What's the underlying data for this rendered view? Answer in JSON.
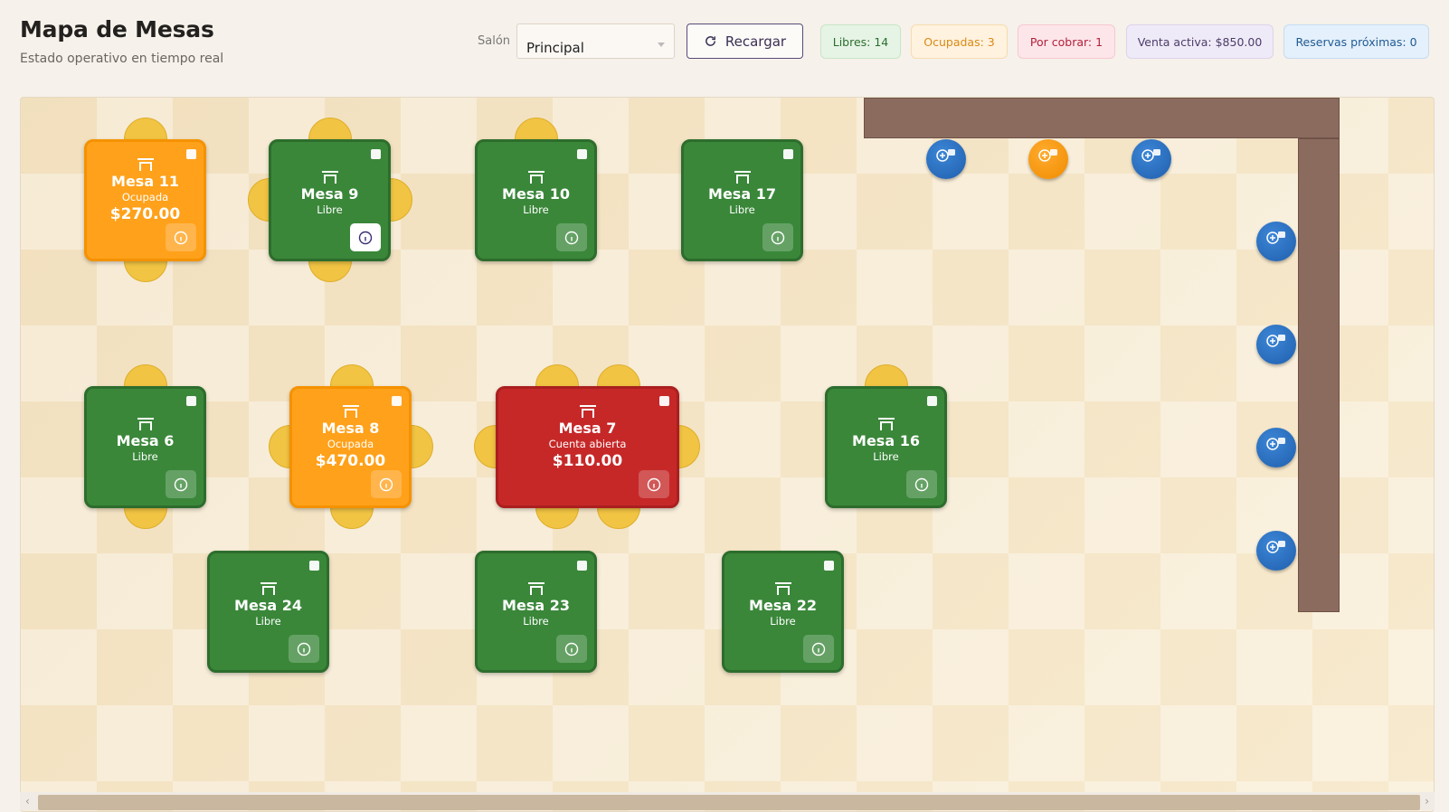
{
  "header": {
    "title": "Mapa de Mesas",
    "subtitle": "Estado operativo en tiempo real",
    "salon_label": "Salón",
    "salon_value": "Principal",
    "reload_label": "Recargar"
  },
  "badges": {
    "libres": "Libres: 14",
    "ocupadas": "Ocupadas: 3",
    "por_cobrar": "Por cobrar: 1",
    "venta_activa": "Venta activa: $850.00",
    "reservas": "Reservas próximas: 0"
  },
  "colors": {
    "libre": "#3a873a",
    "ocupada": "#ffa11a",
    "cuenta_abierta": "#c62828",
    "chair": "#f1c443",
    "wall": "#8c6b5f",
    "stool_free": "#2f74c8",
    "stool_busy": "#f39a14"
  },
  "tables": [
    {
      "name": "Mesa 11",
      "state": "Ocupada",
      "amount": "$270.00"
    },
    {
      "name": "Mesa 9",
      "state": "Libre",
      "amount": ""
    },
    {
      "name": "Mesa 10",
      "state": "Libre",
      "amount": ""
    },
    {
      "name": "Mesa 17",
      "state": "Libre",
      "amount": ""
    },
    {
      "name": "Mesa 6",
      "state": "Libre",
      "amount": ""
    },
    {
      "name": "Mesa 8",
      "state": "Ocupada",
      "amount": "$470.00"
    },
    {
      "name": "Mesa 7",
      "state": "Cuenta abierta",
      "amount": "$110.00"
    },
    {
      "name": "Mesa 16",
      "state": "Libre",
      "amount": ""
    },
    {
      "name": "Mesa 24",
      "state": "Libre",
      "amount": ""
    },
    {
      "name": "Mesa 23",
      "state": "Libre",
      "amount": ""
    },
    {
      "name": "Mesa 22",
      "state": "Libre",
      "amount": ""
    }
  ],
  "icons": {
    "table": "table-icon",
    "info": "info-icon",
    "reload": "refresh-icon",
    "stool": "bar-stool-icon"
  }
}
